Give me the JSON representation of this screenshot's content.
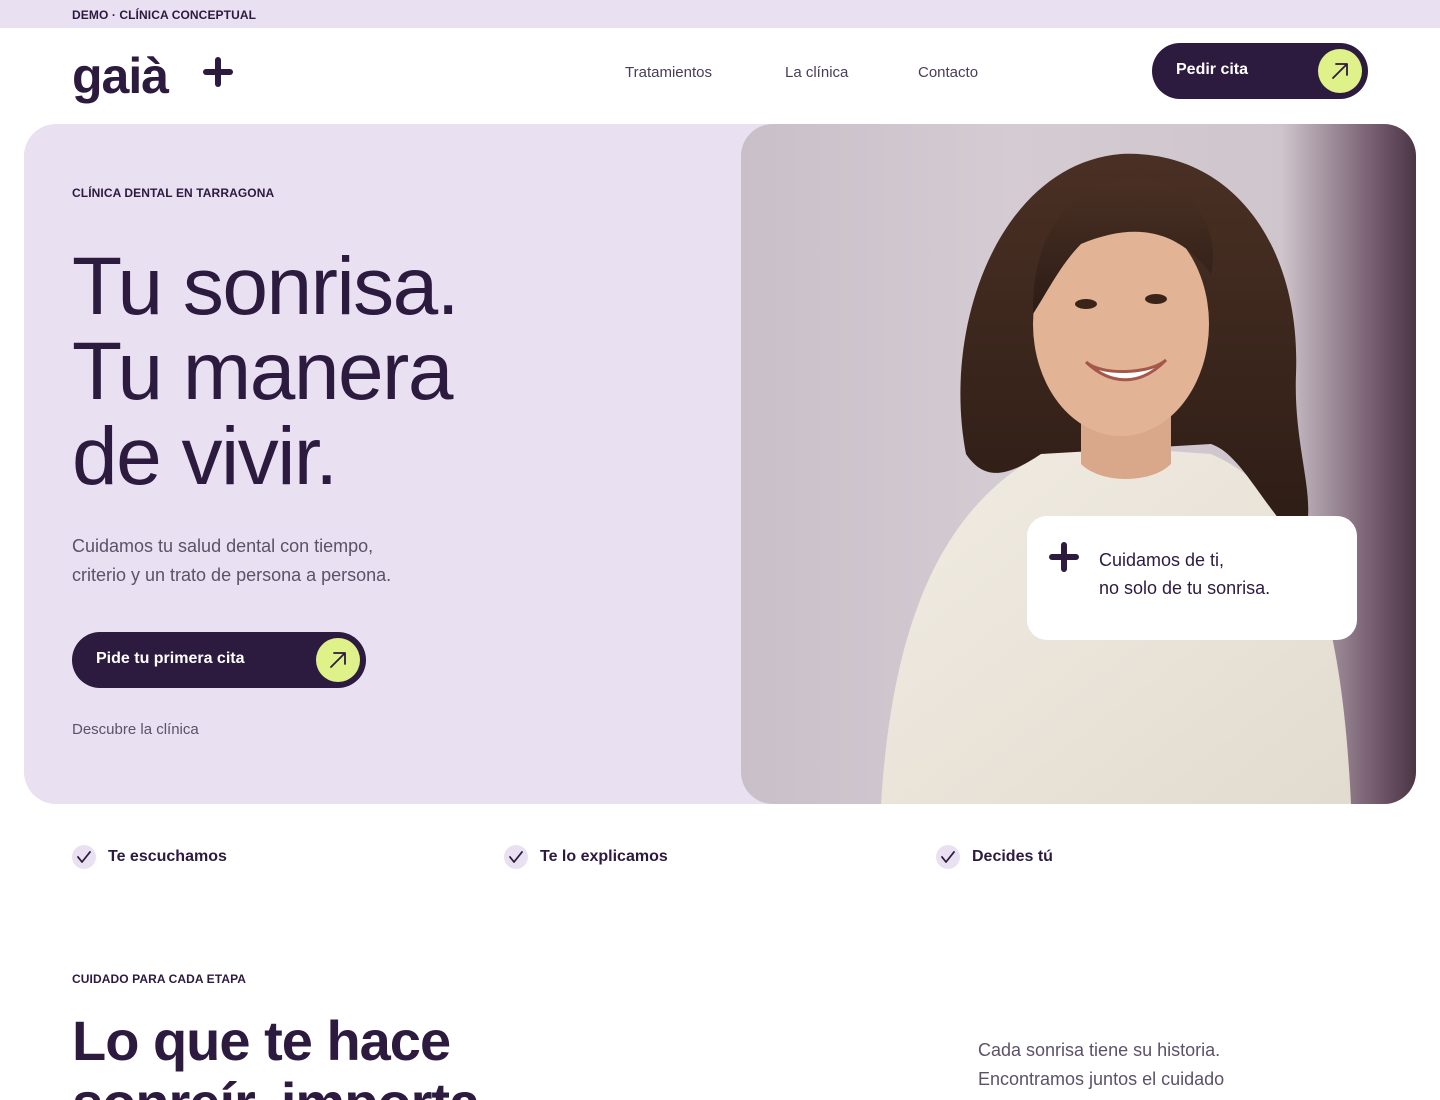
{
  "demo_bar": {
    "text": "DEMO · CLÍNICA CONCEPTUAL"
  },
  "header": {
    "logo_text": "gaià",
    "nav": [
      {
        "label": "Tratamientos"
      },
      {
        "label": "La clínica"
      },
      {
        "label": "Contacto"
      }
    ],
    "cta_label": "Pedir cita"
  },
  "hero": {
    "eyebrow": "CLÍNICA DENTAL EN TARRAGONA",
    "title_lines": [
      "Tu sonrisa.",
      "Tu manera",
      "de vivir."
    ],
    "subtitle_lines": [
      "Cuidamos tu salud dental con tiempo,",
      "criterio y un trato de persona a persona."
    ],
    "cta_label": "Pide tu primera cita",
    "secondary_link": "Descubre la clínica",
    "quote_lines": [
      "Cuidamos de ti,",
      "no solo de tu sonrisa."
    ]
  },
  "features": [
    {
      "label": "Te escuchamos"
    },
    {
      "label": "Te lo explicamos"
    },
    {
      "label": "Decides tú"
    }
  ],
  "section2": {
    "eyebrow": "CUIDADO PARA CADA ETAPA",
    "title_lines": [
      "Lo que te hace",
      "sonreír, importa"
    ],
    "text_lines": [
      "Cada sonrisa tiene su historia.",
      "Encontramos juntos el cuidado"
    ]
  },
  "colors": {
    "primary": "#2d1a3f",
    "lavender": "#e9e0f2",
    "accent_lime": "#dff28a",
    "muted_text": "#5c5268"
  },
  "icons": [
    "plus-icon",
    "arrow-up-right-icon",
    "check-icon"
  ]
}
